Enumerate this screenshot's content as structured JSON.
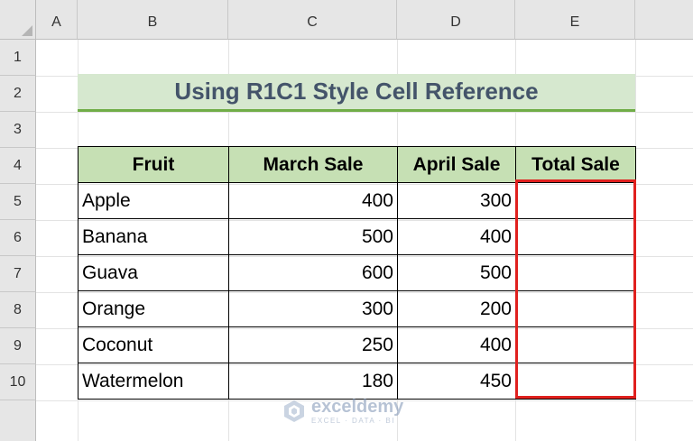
{
  "columns": [
    "A",
    "B",
    "C",
    "D",
    "E"
  ],
  "rows": [
    "1",
    "2",
    "3",
    "4",
    "5",
    "6",
    "7",
    "8",
    "9",
    "10"
  ],
  "title": "Using R1C1 Style Cell Reference",
  "table": {
    "headers": [
      "Fruit",
      "March Sale",
      "April Sale",
      "Total Sale"
    ],
    "rows": [
      {
        "fruit": "Apple",
        "march": "400",
        "april": "300",
        "total": ""
      },
      {
        "fruit": "Banana",
        "march": "500",
        "april": "400",
        "total": ""
      },
      {
        "fruit": "Guava",
        "march": "600",
        "april": "500",
        "total": ""
      },
      {
        "fruit": "Orange",
        "march": "300",
        "april": "200",
        "total": ""
      },
      {
        "fruit": "Coconut",
        "march": "250",
        "april": "400",
        "total": ""
      },
      {
        "fruit": "Watermelon",
        "march": "180",
        "april": "450",
        "total": ""
      }
    ]
  },
  "watermark": {
    "name": "exceldemy",
    "tagline": "EXCEL · DATA · BI"
  },
  "colors": {
    "title_fill": "#d6e8cf",
    "title_text": "#44546a",
    "title_underline": "#70ad47",
    "header_fill": "#c6e0b4",
    "highlight": "#e0201e"
  }
}
